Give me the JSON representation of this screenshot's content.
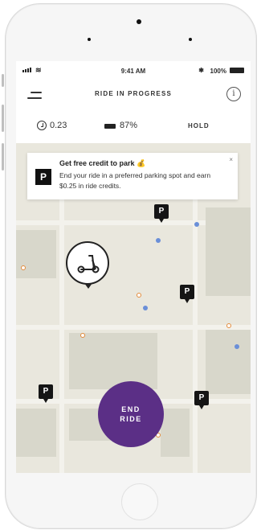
{
  "status_bar": {
    "time": "9:41 AM",
    "battery": "100%"
  },
  "header": {
    "title": "RIDE IN PROGRESS"
  },
  "stats": {
    "distance": "0.23",
    "battery": "87%",
    "hold": "HOLD"
  },
  "banner": {
    "title": "Get free credit to park",
    "body": "End your ride in a preferred parking spot and earn $0.25 in ride credits.",
    "close": "×",
    "icon_letter": "P"
  },
  "parking_markers": [
    "P",
    "P",
    "P",
    "P"
  ],
  "end_ride": {
    "line1": "END",
    "line2": "RIDE"
  },
  "icons": [
    "menu-icon",
    "info-icon",
    "timer-icon",
    "battery-icon",
    "parking-icon",
    "scooter-icon",
    "close-icon"
  ],
  "colors": {
    "accent": "#5b2f86",
    "map_bg": "#e9e7dd",
    "marker": "#151515"
  }
}
